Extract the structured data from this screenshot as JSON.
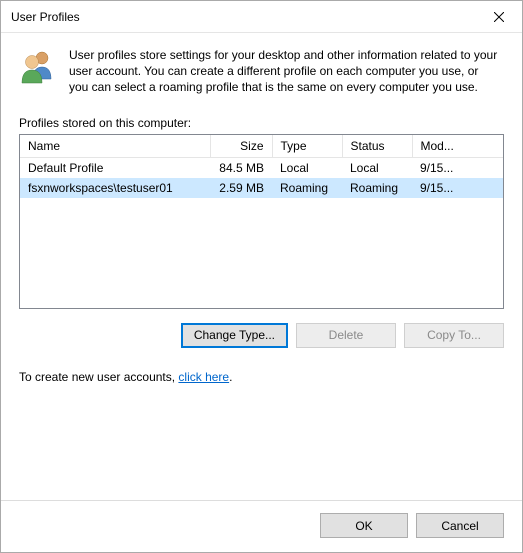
{
  "title": "User Profiles",
  "intro_text": "User profiles store settings for your desktop and other information related to your user account. You can create a different profile on each computer you use, or you can select a roaming profile that is the same on every computer you use.",
  "list_label": "Profiles stored on this computer:",
  "columns": {
    "name": "Name",
    "size": "Size",
    "type": "Type",
    "status": "Status",
    "modified": "Mod..."
  },
  "rows": [
    {
      "name": "Default Profile",
      "size": "84.5 MB",
      "type": "Local",
      "status": "Local",
      "modified": "9/15..."
    },
    {
      "name": "fsxnworkspaces\\testuser01",
      "size": "2.59 MB",
      "type": "Roaming",
      "status": "Roaming",
      "modified": "9/15..."
    }
  ],
  "buttons": {
    "change_type": "Change Type...",
    "delete": "Delete",
    "copy_to": "Copy To...",
    "ok": "OK",
    "cancel": "Cancel"
  },
  "create_account_prefix": "To create new user accounts, ",
  "create_account_link": "click here",
  "create_account_suffix": "."
}
